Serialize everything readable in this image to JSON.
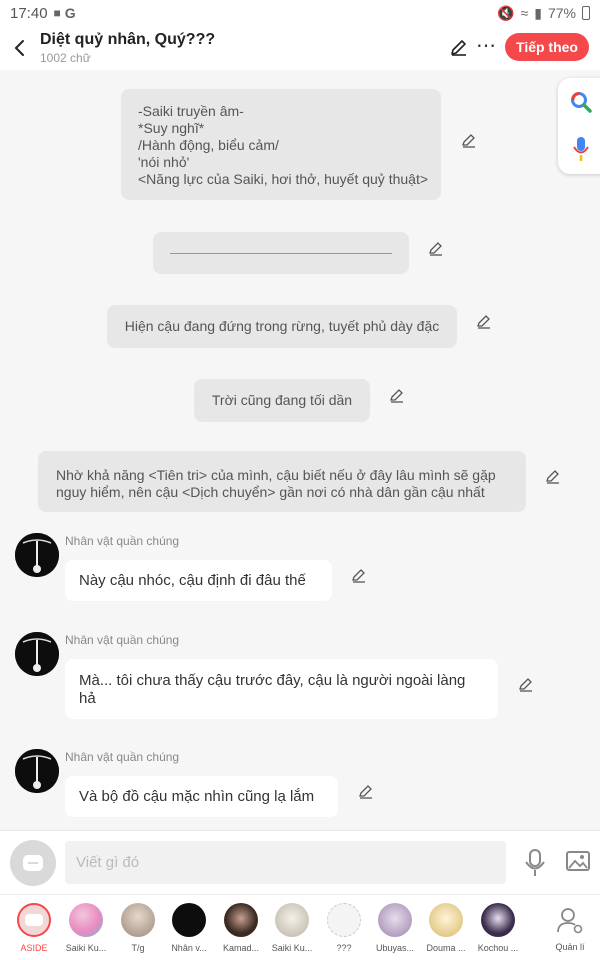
{
  "status_bar": {
    "time": "17:40",
    "battery": "77%"
  },
  "header": {
    "title": "Diệt quỷ nhân, Quý???",
    "subtitle": "1002 chữ",
    "follow_label": "Tiếp theo"
  },
  "narration": [
    {
      "lines": [
        "-Saiki truyền âm-",
        "*Suy nghĩ*",
        "/Hành động, biểu cảm/",
        "'nói nhỏ'",
        "<Năng lực của Saiki, hơi thở, huyết quỷ thuật>"
      ]
    },
    {
      "text": "——————————————————"
    },
    {
      "text": "Hiện cậu đang đứng trong rừng, tuyết phủ dày đặc"
    },
    {
      "text": "Trời cũng đang tối dần"
    },
    {
      "lines": [
        "Nhờ khả năng <Tiên tri> của mình, cậu biết nếu ở đây lâu mình sẽ gặp",
        "nguy hiểm, nên cậu <Dịch chuyển> gần nơi có nhà dân gần cậu nhất"
      ]
    }
  ],
  "messages": [
    {
      "speaker": "Nhân vật quần chúng",
      "text": "Này cậu nhóc, cậu định đi đâu thế"
    },
    {
      "speaker": "Nhân vật quần chúng",
      "lines": [
        "Mà... tôi chưa thấy cậu trước đây, cậu là người ngoài làng",
        "hả"
      ]
    },
    {
      "speaker": "Nhân vật quần chúng",
      "text": "Và bộ đồ cậu mặc nhìn cũng lạ lắm"
    }
  ],
  "input": {
    "placeholder": "Viết gì đó"
  },
  "characters": [
    {
      "label": "ASIDE",
      "color": "#f2d7d7"
    },
    {
      "label": "Saiki Ku...",
      "color": "#e8a0c8"
    },
    {
      "label": "T/g",
      "color": "#c9b9a8"
    },
    {
      "label": "Nhân v...",
      "color": "#0d0d0d"
    },
    {
      "label": "Kamad...",
      "color": "#3a2a22"
    },
    {
      "label": "Saiki Ku...",
      "color": "#d4d0c4"
    },
    {
      "label": "???",
      "color": "#f4f4f4"
    },
    {
      "label": "Ubuyas...",
      "color": "#b8a4c4"
    },
    {
      "label": "Douma ...",
      "color": "#e8d49c"
    },
    {
      "label": "Kochou ...",
      "color": "#3a2c4c"
    },
    {
      "label": "Quản lí",
      "color": "#ffffff"
    }
  ],
  "colors": {
    "accent": "#f4484a",
    "narration_bg": "#e7e7e7",
    "page_bg": "#f6f6f6"
  },
  "icons": [
    "back-icon",
    "pencil-icon",
    "more-icon",
    "google-search-icon",
    "google-mic-icon",
    "mic-icon",
    "image-icon",
    "settings-user-icon"
  ]
}
